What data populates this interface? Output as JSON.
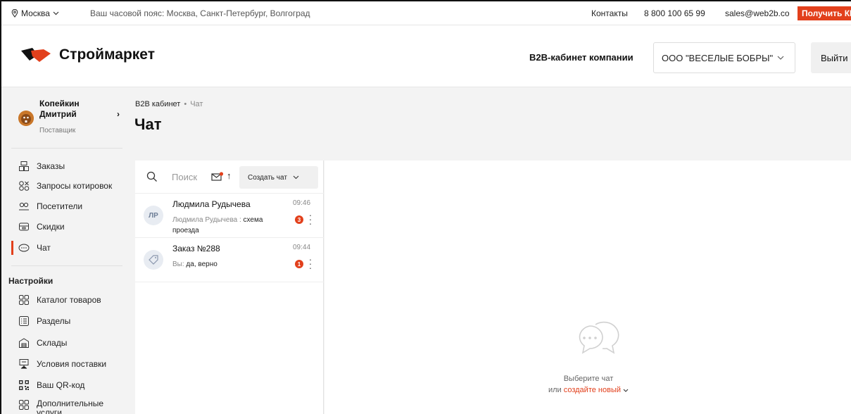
{
  "topbar": {
    "city": "Москва",
    "timezone": "Ваш часовой пояс: Москва, Санкт-Петербург, Волгоград",
    "contacts": "Контакты",
    "phone": "8 800 100 65 99",
    "email": "sales@web2b.co",
    "cta": "Получить КП"
  },
  "header": {
    "logo": "Строймаркет",
    "b2b_label": "B2B-кабинет компании",
    "company": "ООО \"ВЕСЕЛЫЕ БОБРЫ\"",
    "logout": "Выйти"
  },
  "profile": {
    "name": "Копейкин Дмитрий",
    "role": "Поставщик"
  },
  "menu": [
    {
      "label": "Заказы",
      "icon": "orders-icon"
    },
    {
      "label": "Запросы котировок",
      "icon": "quotes-icon"
    },
    {
      "label": "Посетители",
      "icon": "visitors-icon"
    },
    {
      "label": "Скидки",
      "icon": "discounts-icon"
    },
    {
      "label": "Чат",
      "icon": "chat-icon",
      "active": true
    }
  ],
  "settings": {
    "title": "Настройки",
    "items": [
      {
        "label": "Каталог товаров",
        "icon": "catalog-icon"
      },
      {
        "label": "Разделы",
        "icon": "sections-icon"
      },
      {
        "label": "Склады",
        "icon": "warehouse-icon"
      },
      {
        "label": "Условия поставки",
        "icon": "delivery-icon"
      },
      {
        "label": "Ваш QR-код",
        "icon": "qr-icon"
      },
      {
        "label": "Дополнительные услуги",
        "icon": "services-icon"
      }
    ]
  },
  "breadcrumbs": [
    "B2B кабинет",
    "Чат"
  ],
  "page_title": "Чат",
  "chat": {
    "search_placeholder": "Поиск",
    "create_label": "Создать чат",
    "items": [
      {
        "initials": "ЛР",
        "name": "Людмила Рудычева",
        "who": "Людмила Рудычева :",
        "message": "схема проезда",
        "time": "09:46",
        "unread": "3"
      },
      {
        "initials": "",
        "name": "Заказ №288",
        "who": "Вы:",
        "message": "да, верно",
        "time": "09:44",
        "unread": "1"
      }
    ],
    "empty_line1": "Выберите чат",
    "empty_line2_prefix": "или",
    "empty_link": "создайте новый"
  },
  "colors": {
    "accent": "#e2401c"
  }
}
